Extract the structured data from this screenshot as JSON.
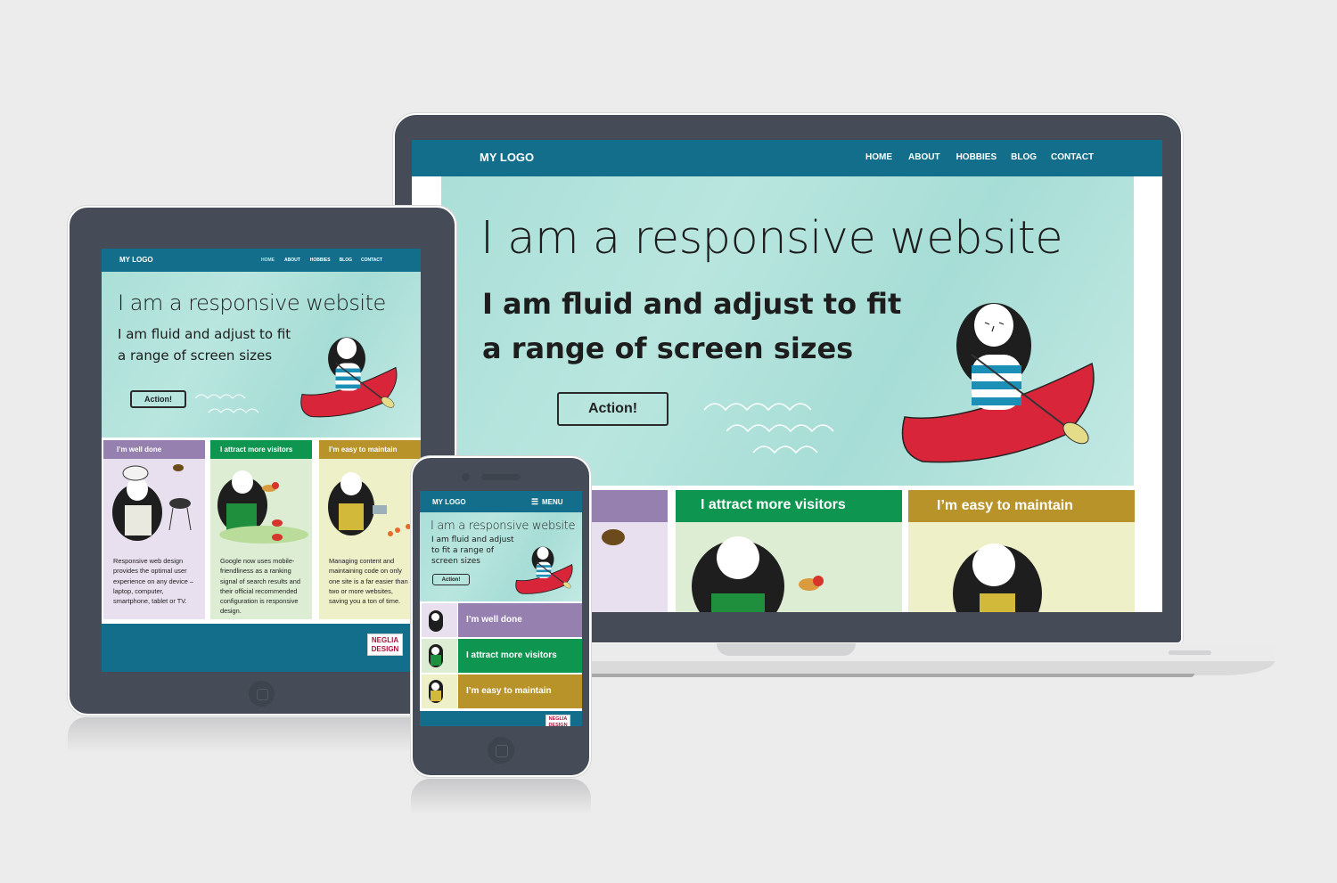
{
  "site": {
    "logo": "MY LOGO",
    "nav": [
      "HOME",
      "ABOUT",
      "HOBBIES",
      "BLOG",
      "CONTACT"
    ],
    "menu_label": "MENU",
    "hero": {
      "title": "I am a responsive website",
      "subtitle": "I am fluid and adjust to fit\na range of screen sizes",
      "subtitle_phone": "I am fluid and adjust\nto fit a range of\nscreen sizes",
      "action_label": "Action!"
    },
    "cards": [
      {
        "title": "I’m well done",
        "color": "#9680b0",
        "bg": "#e8e0ef",
        "body": "Responsive web design provides the optimal user experience on any device – laptop, computer, smartphone, tablet or TV."
      },
      {
        "title": "I attract more visitors",
        "color": "#0e9650",
        "bg": "#dcedd4",
        "body": "Google now uses mobile-friendliness as a ranking signal of search results and their official recommended configuration is responsive design."
      },
      {
        "title": "I’m easy to maintain",
        "color": "#b8932a",
        "bg": "#eef0c8",
        "body": "Managing content and maintaining code on only one site is a far easier than two or more websites, saving you a ton of time."
      }
    ],
    "footer_badge": "NEGLIA\nDESIGN"
  },
  "colors": {
    "nav": "#126e8a",
    "device_body": "#454c57",
    "background": "#ececec"
  }
}
